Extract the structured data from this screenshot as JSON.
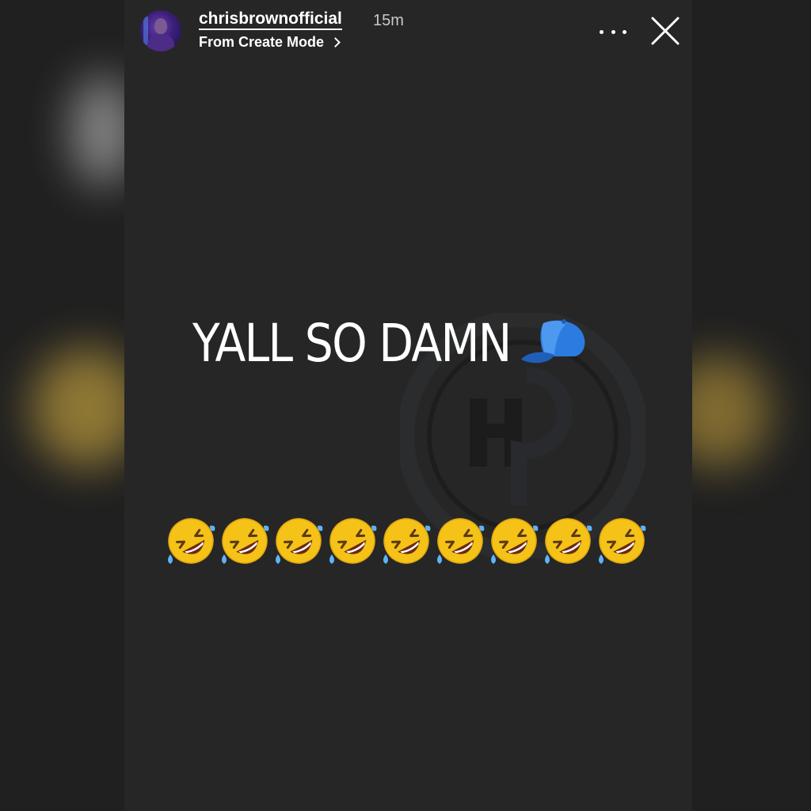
{
  "story": {
    "username": "chrisbrownofficial",
    "time_ago": "15m",
    "subtitle": "From Create Mode",
    "headline": "YALL SO DAMN",
    "headline_emoji": "blue-cap-icon",
    "emoji_row": [
      "rolling-on-floor-laughing-emoji",
      "rolling-on-floor-laughing-emoji",
      "rolling-on-floor-laughing-emoji",
      "rolling-on-floor-laughing-emoji",
      "rolling-on-floor-laughing-emoji",
      "rolling-on-floor-laughing-emoji",
      "rolling-on-floor-laughing-emoji",
      "rolling-on-floor-laughing-emoji",
      "rolling-on-floor-laughing-emoji"
    ]
  },
  "icons": {
    "more": "more-options-icon",
    "close": "close-icon",
    "subtitle_chevron": "chevron-right-icon"
  },
  "colors": {
    "story_background": "#262626",
    "text": "#ffffff",
    "timestamp": "#c9c9c9",
    "cap_blue": "#2b7be0",
    "emoji_yellow": "#f5c218"
  }
}
